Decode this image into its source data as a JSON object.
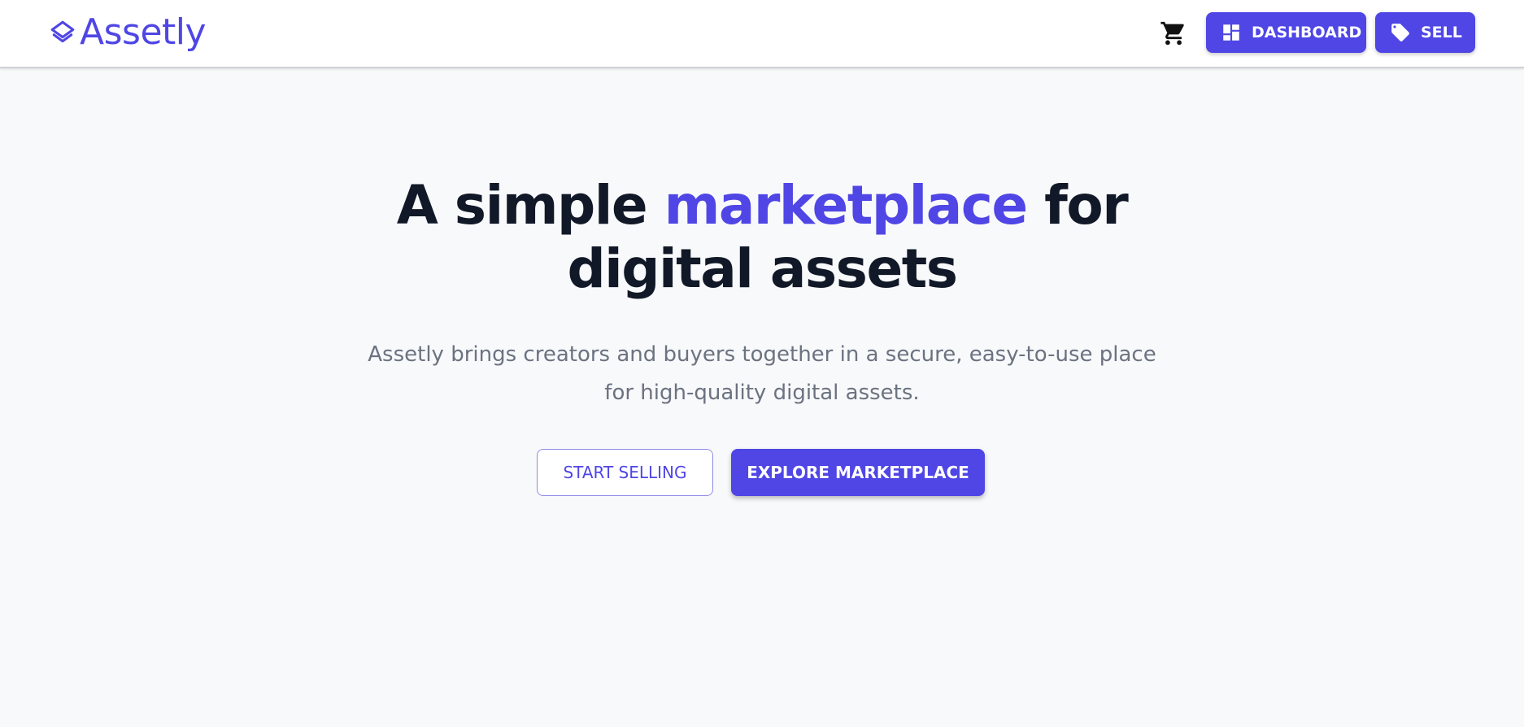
{
  "colors": {
    "brand": "#4f46e5",
    "heading": "#111827",
    "muted": "#6b7280",
    "page_background": "#f8f9fb",
    "header_background": "#ffffff"
  },
  "header": {
    "logo_text": "Assetly",
    "logo_icon": "layers-icon",
    "cart_icon": "cart-icon",
    "dashboard_label": "DASHBOARD",
    "dashboard_icon": "dashboard-icon",
    "sell_label": "SELL",
    "sell_icon": "tag-icon"
  },
  "hero": {
    "title_part1": "A simple ",
    "title_accent": "marketplace",
    "title_part2": " for",
    "title_line2": "digital assets",
    "subtitle_line1": "Assetly brings creators and buyers together in a secure, easy-to-use place",
    "subtitle_line2": "for high-quality digital assets.",
    "cta_secondary": "START SELLING",
    "cta_primary": "EXPLORE MARKETPLACE"
  }
}
